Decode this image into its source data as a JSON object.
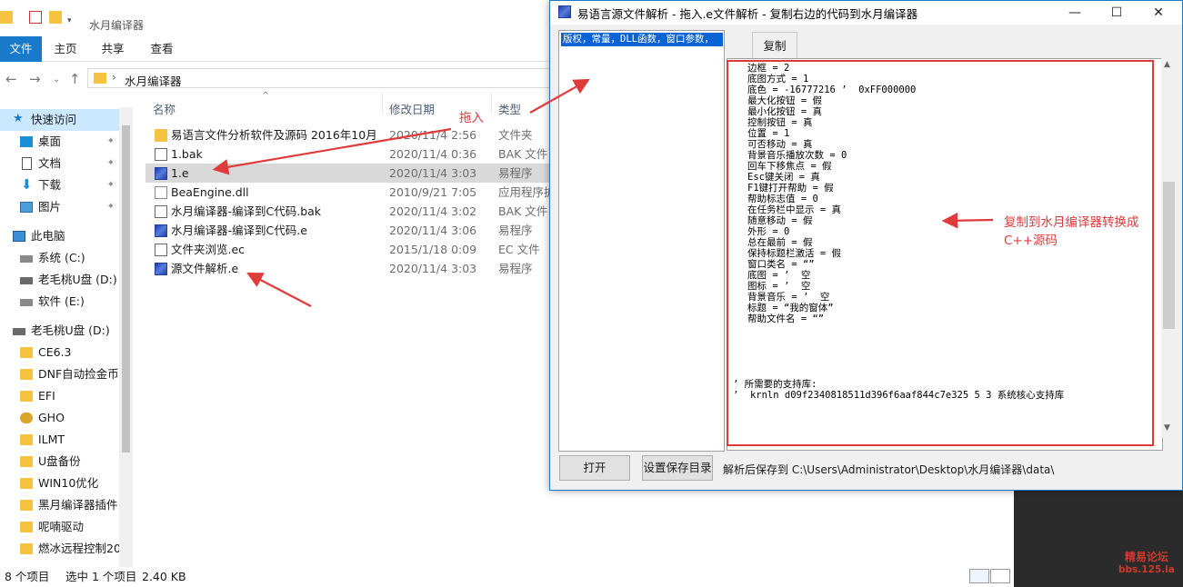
{
  "explorer": {
    "window_title": "水月编译器",
    "ribbon_tabs": [
      "文件",
      "主页",
      "共享",
      "查看"
    ],
    "address_path": "水月编译器",
    "columns": {
      "name": "名称",
      "date": "修改日期",
      "type": "类型"
    },
    "sidebar": [
      {
        "label": "快速访问",
        "icon": "star-icon",
        "pinned": false
      },
      {
        "label": "桌面",
        "icon": "desktop-icon",
        "pinned": true
      },
      {
        "label": "文档",
        "icon": "document-icon",
        "pinned": true
      },
      {
        "label": "下载",
        "icon": "download-icon",
        "pinned": true
      },
      {
        "label": "图片",
        "icon": "picture-icon",
        "pinned": true
      },
      {
        "label": "此电脑",
        "icon": "computer-icon",
        "pinned": false
      },
      {
        "label": "系统 (C:)",
        "icon": "drive-icon",
        "pinned": false
      },
      {
        "label": "老毛桃U盘 (D:)",
        "icon": "usb-drive-icon",
        "pinned": false
      },
      {
        "label": "软件 (E:)",
        "icon": "drive-icon",
        "pinned": false
      },
      {
        "label": "老毛桃U盘 (D:)",
        "icon": "usb-drive-icon",
        "pinned": false
      },
      {
        "label": "CE6.3",
        "icon": "folder-icon",
        "pinned": false
      },
      {
        "label": "DNF自动捡金币",
        "icon": "folder-icon",
        "pinned": false
      },
      {
        "label": "EFI",
        "icon": "folder-icon",
        "pinned": false
      },
      {
        "label": "GHO",
        "icon": "folder-icon",
        "pinned": false
      },
      {
        "label": "ILMT",
        "icon": "folder-icon",
        "pinned": false
      },
      {
        "label": "U盘备份",
        "icon": "folder-icon",
        "pinned": false
      },
      {
        "label": "WIN10优化",
        "icon": "folder-icon",
        "pinned": false
      },
      {
        "label": "黑月编译器插件",
        "icon": "folder-icon",
        "pinned": false
      },
      {
        "label": "呢喃驱动",
        "icon": "folder-icon",
        "pinned": false
      },
      {
        "label": "燃冰远程控制20",
        "icon": "folder-icon",
        "pinned": false
      }
    ],
    "files": [
      {
        "name": "易语言文件分析软件及源码 2016年10月",
        "date": "2020/11/4 2:56",
        "type": "文件夹",
        "icon": "folder-icon"
      },
      {
        "name": "1.bak",
        "date": "2020/11/4 0:36",
        "type": "BAK 文件",
        "icon": "file-icon"
      },
      {
        "name": "1.e",
        "date": "2020/11/4 3:03",
        "type": "易程序",
        "icon": "e-file-icon"
      },
      {
        "name": "BeaEngine.dll",
        "date": "2010/9/21 7:05",
        "type": "应用程序扩",
        "icon": "dll-icon"
      },
      {
        "name": "水月编译器-编译到C代码.bak",
        "date": "2020/11/4 3:02",
        "type": "BAK 文件",
        "icon": "file-icon"
      },
      {
        "name": "水月编译器-编译到C代码.e",
        "date": "2020/11/4 3:06",
        "type": "易程序",
        "icon": "e-file-icon"
      },
      {
        "name": "文件夹浏览.ec",
        "date": "2015/1/18 0:09",
        "type": "EC 文件",
        "icon": "file-icon"
      },
      {
        "name": "源文件解析.e",
        "date": "2020/11/4 3:03",
        "type": "易程序",
        "icon": "e-file-icon"
      }
    ],
    "status": {
      "count": "8 个项目",
      "selected": "选中 1 个项目",
      "size": "2.40 KB"
    }
  },
  "tool": {
    "title": "易语言源文件解析 - 拖入.e文件解析 - 复制右边的代码到水月编译器",
    "list_item": "版权，常量，DLL函数，窗口参数，",
    "copy_tab": "复制",
    "code_lines": [
      "边框 = 2",
      "底图方式 = 1",
      "底色 = -16777216 ’  0xFF000000",
      "最大化按钮 = 假",
      "最小化按钮 = 真",
      "控制按钮 = 真",
      "位置 = 1",
      "可否移动 = 真",
      "背景音乐播放次数 = 0",
      "回车下移焦点 = 假",
      "Esc键关闭 = 真",
      "F1键打开帮助 = 假",
      "帮助标志值 = 0",
      "在任务栏中显示 = 真",
      "随意移动 = 假",
      "外形 = 0",
      "总在最前 = 假",
      "保持标题栏激活 = 假",
      "窗口类名 = “”",
      "底图 = ’  空",
      "图标 = ’  空",
      "背景音乐 = ’  空",
      "标题 = “我的窗体”",
      "帮助文件名 = “”"
    ],
    "support_lines": [
      "’ 所需要的支持库:",
      "’  krnln d09f2340818511d396f6aaf844c7e325 5 3 系统核心支持库"
    ],
    "buttons": {
      "open": "打开",
      "set_dir": "设置保存目录"
    },
    "save_path": "解析后保存到 C:\\Users\\Administrator\\Desktop\\水月编译器\\data\\"
  },
  "annotations": {
    "drag_in": "拖入",
    "copy_hint_line1": "复制到水月编译器转换成",
    "copy_hint_line2": "C++源码"
  },
  "watermark": {
    "line1": "精易论坛",
    "line2": "bbs.125.la"
  },
  "colors": {
    "accent": "#1979ca",
    "selection": "#cce8ff",
    "annotation_red": "#e03b3b",
    "list_highlight": "#0a64d6"
  }
}
